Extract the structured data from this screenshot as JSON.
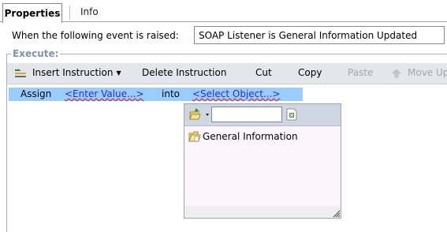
{
  "tabs": [
    {
      "label": "Properties",
      "active": true
    },
    {
      "label": "Info",
      "active": false
    }
  ],
  "event": {
    "label": "When the following event is raised:",
    "value": "SOAP Listener is General Information Updated"
  },
  "execute": {
    "legend": "Execute:"
  },
  "toolbar": {
    "insert_label": "Insert Instruction",
    "delete_label": "Delete Instruction",
    "cut_label": "Cut",
    "copy_label": "Copy",
    "paste_label": "Paste",
    "move_up_label": "Move Up"
  },
  "instruction": {
    "assign": "Assign",
    "value_placeholder": "<Enter Value...>",
    "into": "into",
    "object_placeholder": "<Select Object...>"
  },
  "popup": {
    "search_value": "",
    "items": [
      {
        "label": "General Information",
        "icon": "folder-icon"
      }
    ]
  },
  "colors": {
    "selected_row": "#99ccff",
    "legend": "#7b93af",
    "link": "#2b2bd0",
    "toolbar_bg": "#e3e6ea"
  }
}
